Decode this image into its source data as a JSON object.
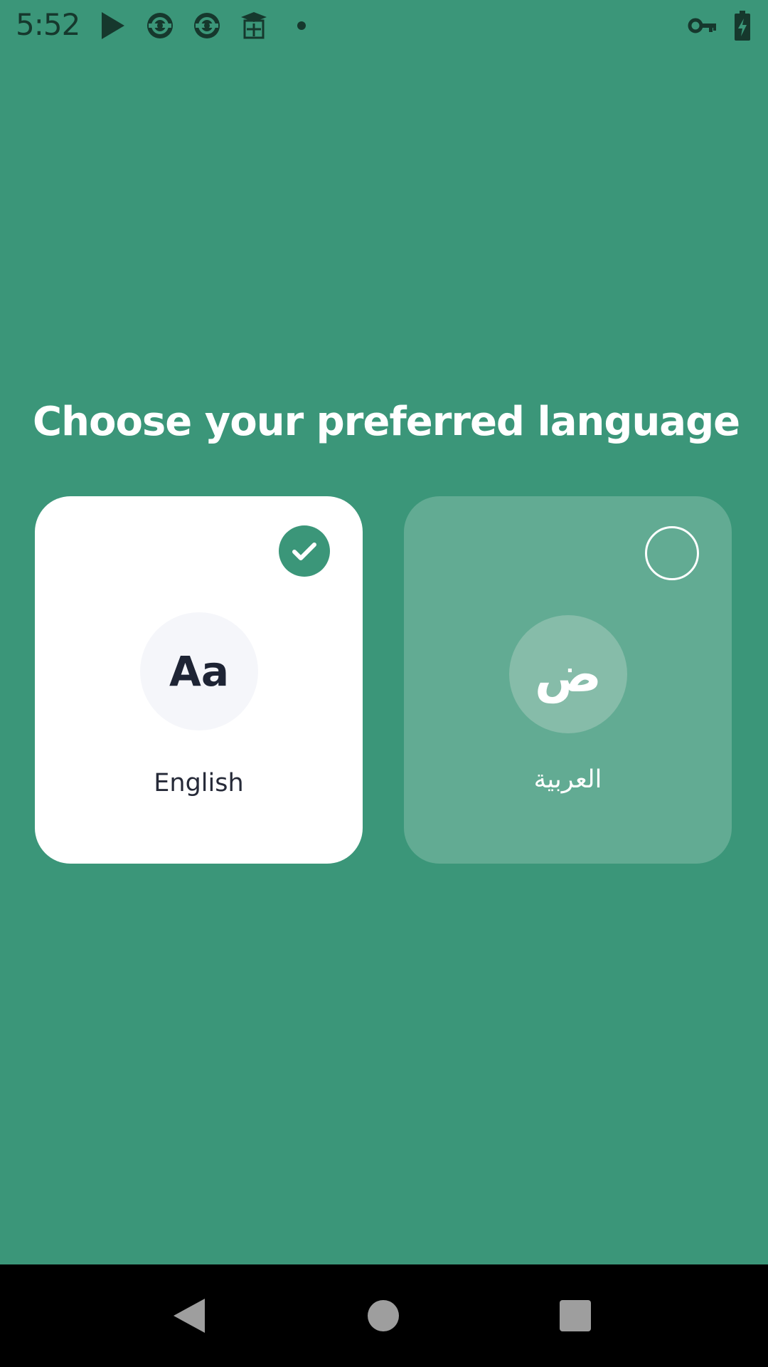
{
  "status_bar": {
    "time": "5:52",
    "icons_left": [
      "play-store-icon",
      "sync-icon",
      "sync-icon",
      "graduation-cap-icon",
      "notification-dot-icon"
    ],
    "icons_right": [
      "vpn-key-icon",
      "battery-charging-icon"
    ]
  },
  "page": {
    "title": "Choose your preferred language"
  },
  "languages": [
    {
      "glyph": "Aa",
      "label": "English",
      "selected": true
    },
    {
      "glyph": "ض",
      "label": "العربية",
      "selected": false
    }
  ],
  "nav_bar": {
    "icons": [
      "back-icon",
      "home-icon",
      "recents-icon"
    ]
  },
  "colors": {
    "background": "#3b9679",
    "selected_card": "#ffffff",
    "unselected_card": "#62ab93",
    "status_icons": "#16382d",
    "nav_bar": "#000000"
  }
}
